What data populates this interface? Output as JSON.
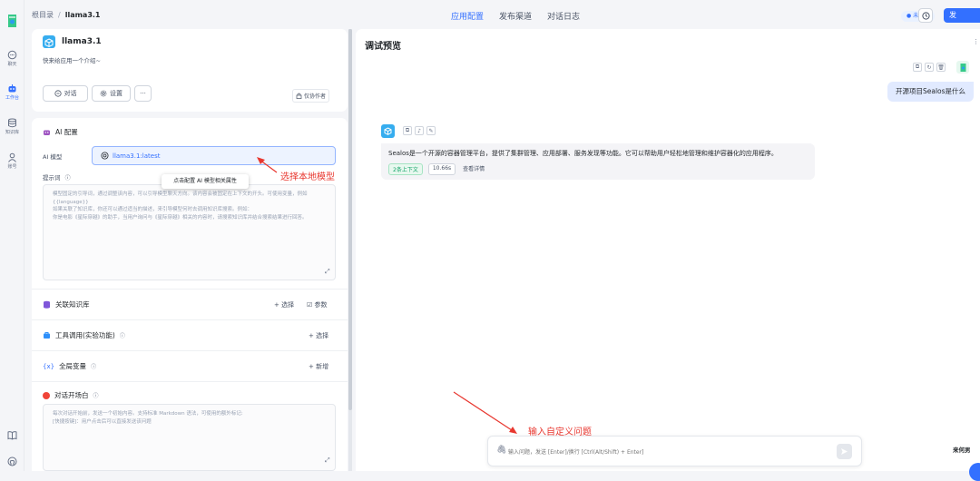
{
  "nav": {
    "items": [
      {
        "label": "聊天",
        "icon": "chat-icon"
      },
      {
        "label": "工作台",
        "icon": "robot-icon",
        "active": true
      },
      {
        "label": "知识库",
        "icon": "database-icon"
      },
      {
        "label": "账号",
        "icon": "user-icon"
      }
    ]
  },
  "breadcrumb": {
    "root": "根目录",
    "sep": "/",
    "current": "llama3.1"
  },
  "header": {
    "tabs": [
      "应用配置",
      "发布渠道",
      "对话日志"
    ],
    "status": "● 未发布",
    "publish": "发"
  },
  "app": {
    "name": "llama3.1",
    "intro": "快来给应用一个介绍~",
    "chat_btn": "对话",
    "settings_btn": "设置",
    "more_btn": "···",
    "auth_label": "仅协作者"
  },
  "config": {
    "ai_title": "AI 配置",
    "model_label": "AI 模型",
    "model_value": "llama3.1:latest",
    "prompt_label": "提示词",
    "prompt_placeholder": "模型固定的引导词，通过调整该内容，可以引导模型聊天方向。该内容会被固定在上下文的开头。可使用变量，例如 {{language}}\n如果关联了知识库，你还可以通过适当的描述，来引导模型何时去调用知识库搜索。例如：\n你是电影《星际穿越》的助手，当用户询问与《星际穿越》相关的内容时，请搜索知识库并结合搜索结果进行回答。",
    "tooltip": "点击配置 AI 模型相关属性",
    "kb_title": "关联知识库",
    "kb_select": "+ 选择",
    "kb_params": "参数",
    "tools_title": "工具调用(实验功能)",
    "tools_select": "+ 选择",
    "vars_title": "全局变量",
    "vars_add": "+ 新增",
    "welcome_title": "对话开场白",
    "welcome_placeholder": "每次对话开始前，发送一个初始内容。支持标准 Markdown 语法，可使用的额外标记:\n[快捷按键]：用户点击后可以直接发送该问题"
  },
  "debug": {
    "title": "调试预览",
    "user_message": "开源项目Sealos是什么",
    "bot_message": "Sealos是一个开源的容器管理平台，提供了集群管理、应用部署、服务发现等功能。它可以帮助用户轻松地管理和维护容器化的应用程序。",
    "ctx_tag": "2条上下文",
    "time_tag": "10.66s",
    "detail_link": "查看详情",
    "input_placeholder": "输入问题，发送 [Enter]/换行 [Ctrl(Alt/Shift) + Enter]",
    "corner_text": "来何男"
  },
  "annotations": {
    "model": "选择本地模型",
    "input": "输入自定义问题"
  },
  "colors": {
    "accent": "#3370ff",
    "annotation": "#e8372f"
  }
}
